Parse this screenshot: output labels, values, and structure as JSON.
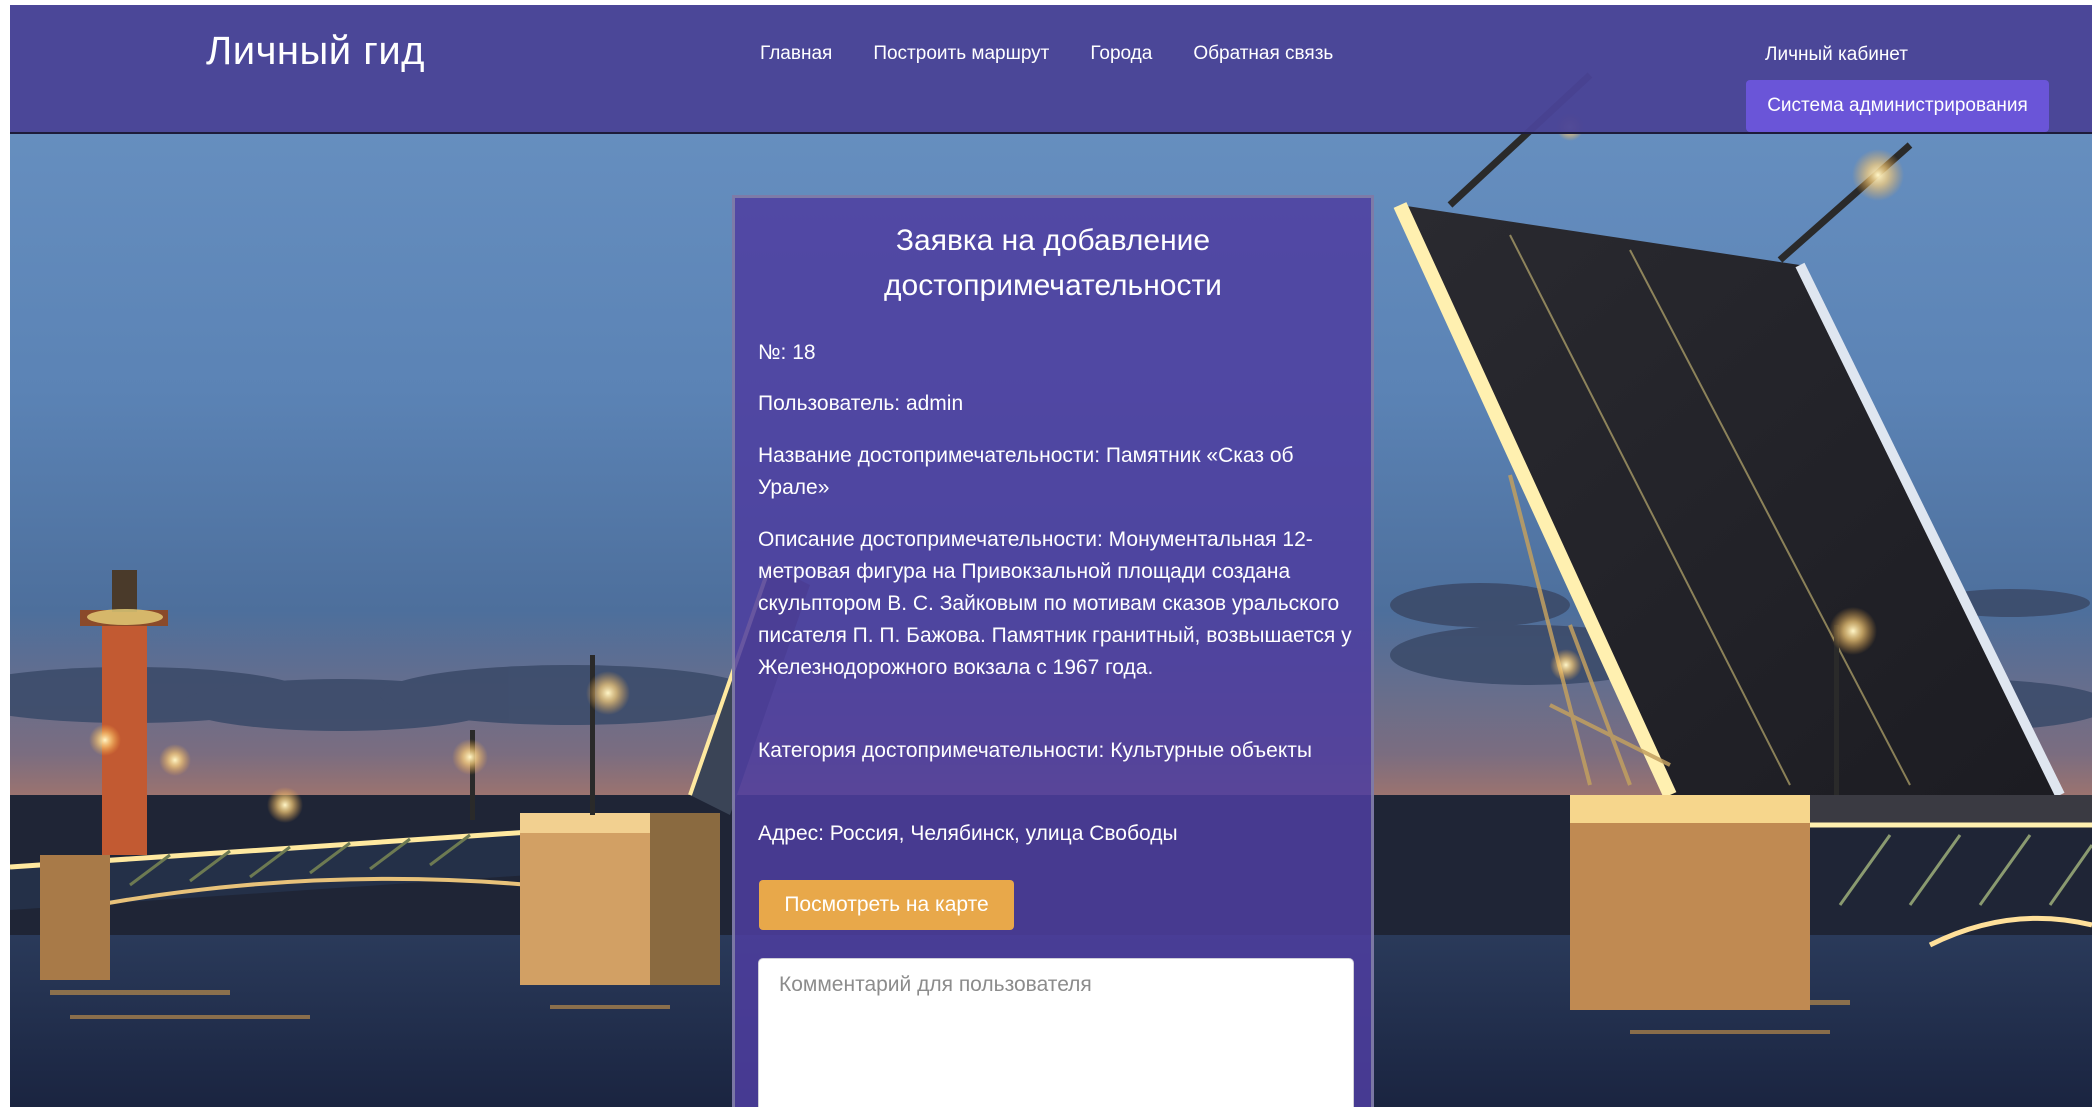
{
  "header": {
    "brand": "Личный гид",
    "nav": [
      "Главная",
      "Построить маршрут",
      "Города",
      "Обратная связь"
    ],
    "cabinet": "Личный кабинет",
    "admin_button": "Система администрирования"
  },
  "card": {
    "title": "Заявка на добавление достопримечательности",
    "number": "№: 18",
    "user": "Пользователь: admin",
    "name": "Название достопримечательности: Памятник «Сказ об Урале»",
    "description": "Описание достопримечательности: Монументальная 12-метровая фигура на Привокзальной площади создана скульптором В. С. Зайковым по мотивам сказов уральского писателя П. П. Бажова. Памятник гранитный, возвышается у Железнодорожного вокзала с 1967 года.",
    "category": "Категория достопримечательности: Культурные объекты",
    "address": "Адрес: Россия, Челябинск, улица Свободы",
    "map_button": "Посмотреть на карте",
    "comment_placeholder": "Комментарий для пользователя",
    "comment_value": ""
  },
  "colors": {
    "header_bg": "#4a4496",
    "admin_button_bg": "#6a55d8",
    "card_bg": "#4e3ea0",
    "map_button_bg": "#e8a84a"
  }
}
